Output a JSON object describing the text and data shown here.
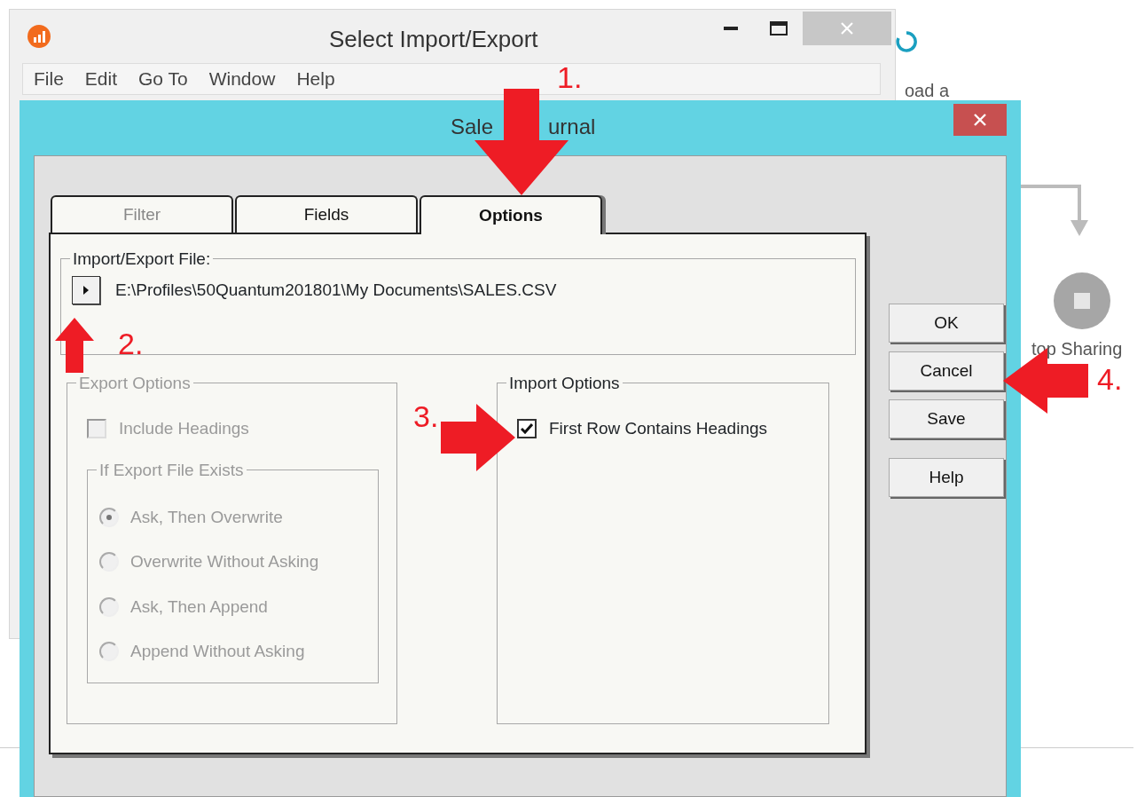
{
  "background": {
    "texts": [
      "oad a",
      "top Sharing"
    ]
  },
  "main_window": {
    "title": "Select Import/Export",
    "menu": [
      "File",
      "Edit",
      "Go To",
      "Window",
      "Help"
    ]
  },
  "dialog": {
    "title_parts": [
      "Sale",
      "urnal"
    ],
    "tabs": [
      {
        "label": "Filter",
        "selected": false,
        "disabled": true
      },
      {
        "label": "Fields",
        "selected": false,
        "disabled": false
      },
      {
        "label": "Options",
        "selected": true,
        "disabled": false
      }
    ],
    "file_group": {
      "label": "Import/Export File:",
      "path": "E:\\Profiles\\50Quantum201801\\My Documents\\SALES.CSV"
    },
    "export_options": {
      "label": "Export Options",
      "disabled": true,
      "include_headings": {
        "label": "Include Headings",
        "checked": false
      },
      "exists_group": {
        "label": "If Export File Exists",
        "options": [
          {
            "label": "Ask, Then Overwrite",
            "selected": true
          },
          {
            "label": "Overwrite Without Asking",
            "selected": false
          },
          {
            "label": "Ask, Then Append",
            "selected": false
          },
          {
            "label": "Append Without Asking",
            "selected": false
          }
        ]
      }
    },
    "import_options": {
      "label": "Import Options",
      "disabled": false,
      "first_row": {
        "label": "First Row Contains Headings",
        "checked": true
      }
    },
    "buttons": [
      "OK",
      "Cancel",
      "Save",
      "Help"
    ]
  },
  "annotations": [
    {
      "number": "1.",
      "kind": "down"
    },
    {
      "number": "2.",
      "kind": "up"
    },
    {
      "number": "3.",
      "kind": "right"
    },
    {
      "number": "4.",
      "kind": "left"
    }
  ]
}
